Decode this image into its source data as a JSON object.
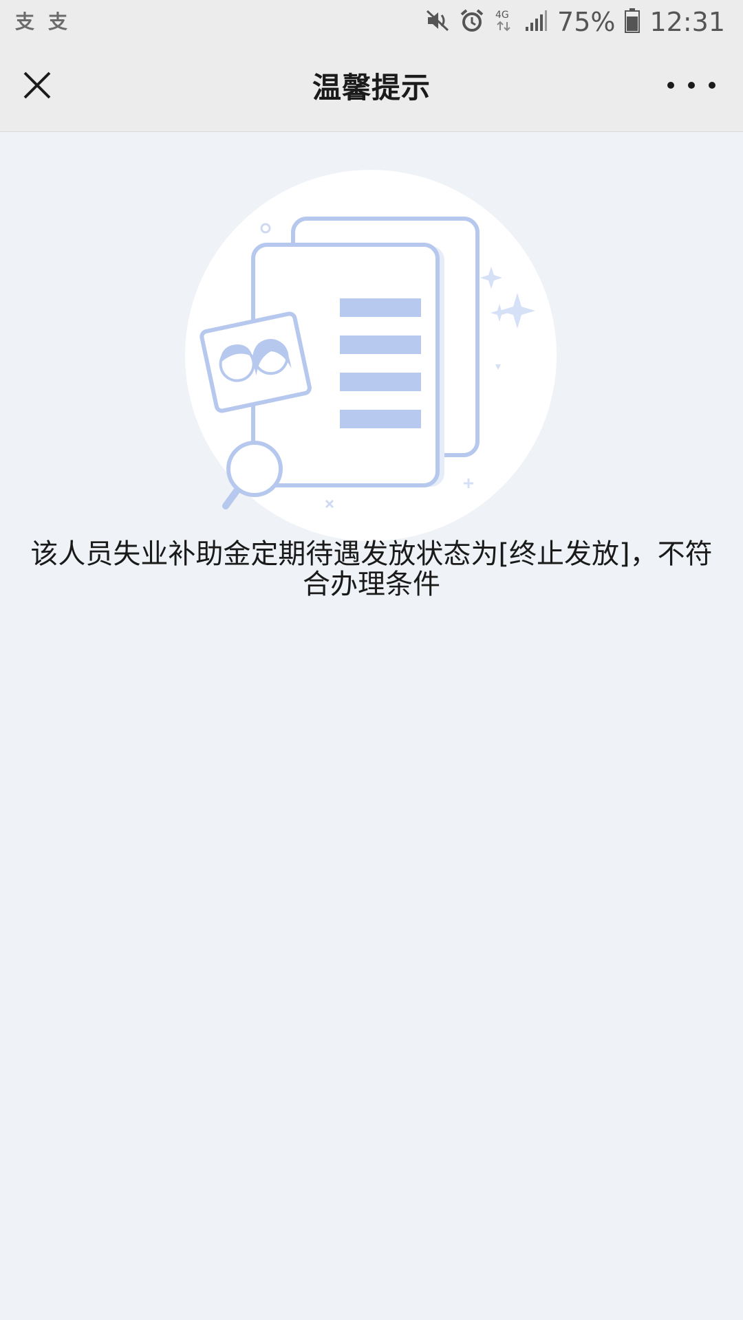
{
  "status_bar": {
    "notification_icons": [
      "支",
      "支"
    ],
    "battery": "75%",
    "time": "12:31",
    "network": "4G",
    "icons": [
      "mute-icon",
      "alarm-icon",
      "network-4g-icon",
      "signal-icon",
      "battery-icon"
    ]
  },
  "nav": {
    "title": "温馨提示",
    "close_icon": "close-icon",
    "more_icon": "more-icon"
  },
  "content": {
    "illustration": "document-search-icon",
    "message": "该人员失业补助金定期待遇发放状态为[终止发放]，不符合办理条件"
  },
  "colors": {
    "background": "#eff2f6",
    "nav_background": "#ececec",
    "illustration_stroke": "#b6c8ee",
    "illustration_fill": "#b8c9ef"
  }
}
